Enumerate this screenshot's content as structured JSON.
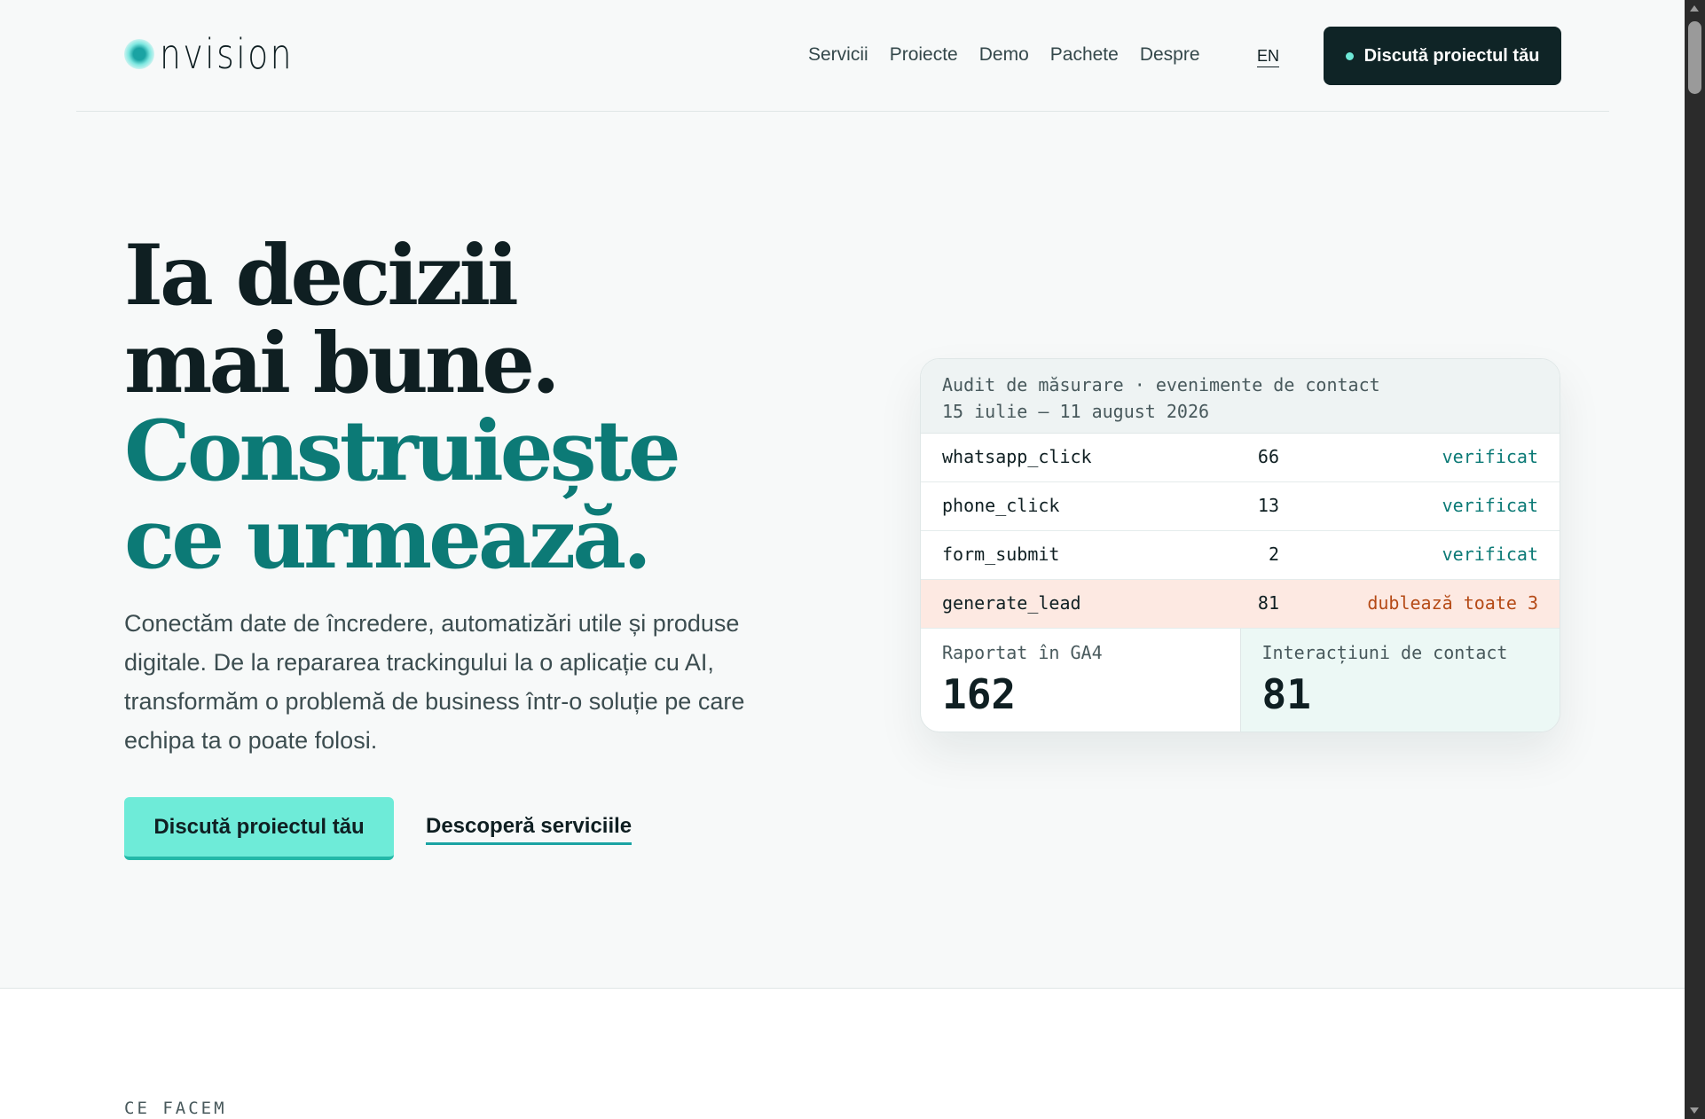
{
  "brand": {
    "name": "nvision"
  },
  "nav": {
    "items": [
      "Servicii",
      "Proiecte",
      "Demo",
      "Pachete",
      "Despre"
    ],
    "lang": "EN",
    "cta_label": "Discută proiectul tău"
  },
  "hero": {
    "title_line1": "Ia decizii",
    "title_line2": "mai bune.",
    "title_line3": "Construiește",
    "title_line4": "ce urmează.",
    "description": "Conectăm date de încredere, automatizări utile și produse digitale. De la repararea trackingului la o aplicație cu AI, transformăm o problemă de business într-o soluție pe care echipa ta o poate folosi.",
    "primary_button": "Discută proiectul tău",
    "secondary_link": "Descoperă serviciile"
  },
  "audit": {
    "title": "Audit de măsurare · evenimente de contact",
    "period": "15 iulie – 11 august 2026",
    "rows": [
      {
        "event": "whatsapp_click",
        "count": "66",
        "status": "verificat"
      },
      {
        "event": "phone_click",
        "count": "13",
        "status": "verificat"
      },
      {
        "event": "form_submit",
        "count": "2",
        "status": "verificat"
      },
      {
        "event": "generate_lead",
        "count": "81",
        "status": "dublează toate 3"
      }
    ],
    "reported_label": "Raportat în GA4",
    "reported_value": "162",
    "interactions_label": "Interacțiuni de contact",
    "interactions_value": "81"
  },
  "section2": {
    "eyebrow": "CE FACEM"
  },
  "colors": {
    "accent": "#0c7a76",
    "button": "#6eebd8",
    "dark": "#0f2426",
    "warning_bg": "#fde9e2",
    "warning_text": "#b54a16"
  }
}
